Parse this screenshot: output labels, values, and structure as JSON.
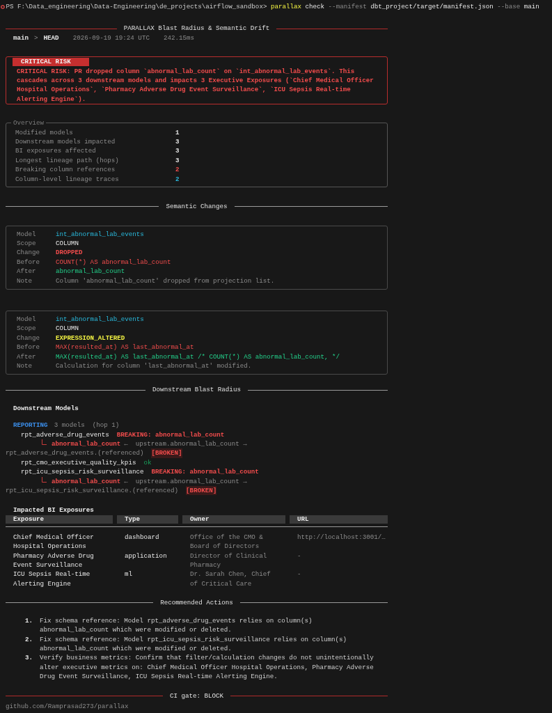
{
  "prompt": {
    "path": "PS F:\\Data_engineering\\Data-Engineering\\de_projects\\airflow_sandbox>",
    "tokens": [
      {
        "text": "parallax",
        "kind": "command"
      },
      {
        "text": "check",
        "kind": "arg"
      },
      {
        "text": "--manifest",
        "kind": "flag"
      },
      {
        "text": "dbt_project/target/manifest.json",
        "kind": "arg"
      },
      {
        "text": "--base",
        "kind": "flag"
      },
      {
        "text": "main",
        "kind": "arg"
      }
    ]
  },
  "banner": {
    "title": "PARALLAX  Blast Radius & Semantic Drift"
  },
  "meta": {
    "base": "main",
    "separator": ">",
    "head": "HEAD",
    "timestamp": "2026-09-19 19:24 UTC",
    "duration": "242.15ms"
  },
  "risk": {
    "label": "CRITICAL RISK",
    "message": "CRITICAL RISK: PR dropped column `abnormal_lab_count` on `int_abnormal_lab_events`. This cascades across 3 downstream models and impacts 3 Executive Exposures (`Chief Medical Officer Hospital Operations`, `Pharmacy Adverse Drug Event Surveillance`, `ICU Sepsis Real-time Alerting Engine`)."
  },
  "overview": {
    "title": "Overview",
    "rows": [
      {
        "label": "Modified models",
        "value": "1",
        "color": "#e5e5e5"
      },
      {
        "label": "Downstream models impacted",
        "value": "3",
        "color": "#e5e5e5"
      },
      {
        "label": "BI exposures affected",
        "value": "3",
        "color": "#e5e5e5"
      },
      {
        "label": "Longest lineage path (hops)",
        "value": "3",
        "color": "#e5e5e5"
      },
      {
        "label": "Breaking column references",
        "value": "2",
        "color": "#f14c4c"
      },
      {
        "label": "Column-level lineage traces",
        "value": "2",
        "color": "#29b8db"
      }
    ]
  },
  "semantic_changes": {
    "title": "Semantic Changes",
    "cards": [
      {
        "fields": [
          {
            "label": "Model",
            "value": "int_abnormal_lab_events",
            "kind": "model"
          },
          {
            "label": "Scope",
            "value": "COLUMN",
            "kind": "scope"
          },
          {
            "label": "Change",
            "value": "DROPPED",
            "kind": "dropped"
          },
          {
            "label": "Before",
            "value": "COUNT(*) AS abnormal_lab_count",
            "kind": "before"
          },
          {
            "label": "After",
            "value": "abnormal_lab_count",
            "kind": "after"
          },
          {
            "label": "Note",
            "value": "Column 'abnormal_lab_count' dropped from projection list.",
            "kind": "note"
          }
        ]
      },
      {
        "fields": [
          {
            "label": "Model",
            "value": "int_abnormal_lab_events",
            "kind": "model"
          },
          {
            "label": "Scope",
            "value": "COLUMN",
            "kind": "scope"
          },
          {
            "label": "Change",
            "value": "EXPRESSION_ALTERED",
            "kind": "altered"
          },
          {
            "label": "Before",
            "value": "MAX(resulted_at) AS last_abnormal_at",
            "kind": "before"
          },
          {
            "label": "After",
            "value": "MAX(resulted_at) AS last_abnormal_at /* COUNT(*) AS abnormal_lab_count, */",
            "kind": "after"
          },
          {
            "label": "Note",
            "value": "Calculation for column 'last_abnormal_at' modified.",
            "kind": "note"
          }
        ]
      }
    ]
  },
  "blast_radius": {
    "title": "Downstream Blast Radius",
    "heading": "Downstream Models",
    "layer": "REPORTING",
    "layer_info": "3 models  (hop 1)",
    "models": [
      {
        "name": "rpt_adverse_drug_events",
        "breaking": true,
        "status": "BREAKING: abnormal_lab_count",
        "traces": [
          {
            "column": "abnormal_lab_count",
            "link": "←  upstream.abnormal_lab_count →",
            "target": "rpt_adverse_drug_events.(referenced)",
            "flag": "[BROKEN]"
          }
        ]
      },
      {
        "name": "rpt_cmo_executive_quality_kpis",
        "breaking": false,
        "status": "ok"
      },
      {
        "name": "rpt_icu_sepsis_risk_surveillance",
        "breaking": true,
        "status": "BREAKING: abnormal_lab_count",
        "traces": [
          {
            "column": "abnormal_lab_count",
            "link": "←  upstream.abnormal_lab_count →",
            "target": "rpt_icu_sepsis_risk_surveillance.(referenced)",
            "flag": "[BROKEN]"
          }
        ]
      }
    ]
  },
  "exposures": {
    "title": "Impacted BI Exposures",
    "columns": [
      "Exposure",
      "Type",
      "Owner",
      "URL"
    ],
    "rows": [
      {
        "exposure": "Chief Medical Officer Hospital Operations",
        "type": "dashboard",
        "owner": "Office of the CMO & Board of Directors",
        "url": "http://localhost:3001/…"
      },
      {
        "exposure": "Pharmacy Adverse Drug Event Surveillance",
        "type": "application",
        "owner": "Director of Clinical Pharmacy",
        "url": "-"
      },
      {
        "exposure": "ICU Sepsis Real-time Alerting Engine",
        "type": "ml",
        "owner": "Dr. Sarah Chen, Chief of Critical Care",
        "url": "-"
      }
    ]
  },
  "recommended_actions": {
    "title": "Recommended Actions",
    "items": [
      {
        "number": "1.",
        "text": "Fix schema reference: Model rpt_adverse_drug_events relies on column(s) abnormal_lab_count which were modified or deleted."
      },
      {
        "number": "2.",
        "text": "Fix schema reference: Model rpt_icu_sepsis_risk_surveillance relies on column(s) abnormal_lab_count which were modified or deleted."
      },
      {
        "number": "3.",
        "text": "Verify business metrics: Confirm that filter/calculation changes do not unintentionally alter executive metrics on: Chief Medical Officer Hospital Operations, Pharmacy Adverse Drug Event Surveillance, ICU Sepsis Real-time Alerting Engine."
      }
    ]
  },
  "ci_gate": {
    "title": "CI gate: BLOCK"
  },
  "footer": {
    "link": "github.com/Ramprasad273/parallax"
  }
}
